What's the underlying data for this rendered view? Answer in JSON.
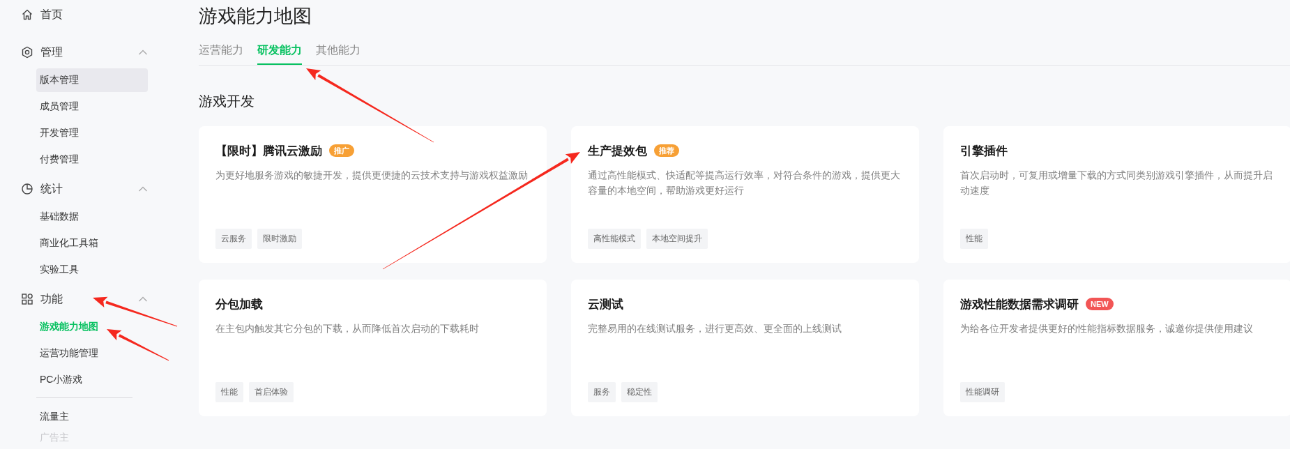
{
  "sidebar": {
    "items": [
      {
        "label": "首页",
        "kind": "home"
      },
      {
        "label": "管理",
        "kind": "hexagon",
        "expanded": true,
        "children": [
          {
            "label": "版本管理",
            "selected": false,
            "highlighted": true
          },
          {
            "label": "成员管理",
            "selected": false,
            "highlighted": false
          },
          {
            "label": "开发管理",
            "selected": false,
            "highlighted": false
          },
          {
            "label": "付费管理",
            "selected": false,
            "highlighted": false
          }
        ]
      },
      {
        "label": "统计",
        "kind": "pie",
        "expanded": true,
        "children": [
          {
            "label": "基础数据",
            "selected": false,
            "highlighted": false
          },
          {
            "label": "商业化工具箱",
            "selected": false,
            "highlighted": false
          },
          {
            "label": "实验工具",
            "selected": false,
            "highlighted": false
          }
        ]
      },
      {
        "label": "功能",
        "kind": "grid",
        "expanded": true,
        "children": [
          {
            "label": "游戏能力地图",
            "selected": true,
            "highlighted": false
          },
          {
            "label": "运营功能管理",
            "selected": false,
            "highlighted": false
          },
          {
            "label": "PC小游戏",
            "selected": false,
            "highlighted": false
          }
        ]
      }
    ],
    "extra_items": [
      {
        "label": "流量主",
        "faded": false
      },
      {
        "label": "广告主",
        "faded": true
      }
    ]
  },
  "page_title": "游戏能力地图",
  "tabs": [
    {
      "label": "运营能力",
      "selected": false
    },
    {
      "label": "研发能力",
      "selected": true
    },
    {
      "label": "其他能力",
      "selected": false
    }
  ],
  "section_title": "游戏开发",
  "cards": [
    {
      "title": "【限时】腾讯云激励",
      "badge": {
        "text": "推广",
        "kind": "hot"
      },
      "description": "为更好地服务游戏的敏捷开发，提供更便捷的云技术支持与游戏权益激励",
      "tags": [
        "云服务",
        "限时激励"
      ]
    },
    {
      "title": "生产提效包",
      "badge": {
        "text": "推荐",
        "kind": "hot"
      },
      "description": "通过高性能模式、快适配等提高运行效率，对符合条件的游戏，提供更大容量的本地空间，帮助游戏更好运行",
      "tags": [
        "高性能模式",
        "本地空间提升"
      ]
    },
    {
      "title": "引擎插件",
      "description": "首次启动时，可复用或增量下载的方式同类别游戏引擎插件，从而提升启动速度",
      "tags": [
        "性能"
      ]
    },
    {
      "title": "分包加载",
      "description": "在主包内触发其它分包的下载，从而降低首次启动的下载耗时",
      "tags": [
        "性能",
        "首启体验"
      ]
    },
    {
      "title": "云测试",
      "description": "完整易用的在线测试服务，进行更高效、更全面的上线测试",
      "tags": [
        "服务",
        "稳定性"
      ]
    },
    {
      "title": "游戏性能数据需求调研",
      "badge": {
        "text": "NEW",
        "kind": "new"
      },
      "description": "为给各位开发者提供更好的性能指标数据服务，诚邀你提供使用建议",
      "tags": [
        "性能调研"
      ]
    }
  ]
}
